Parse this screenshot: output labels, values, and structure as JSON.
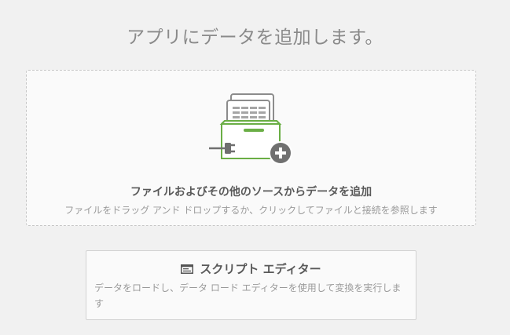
{
  "page": {
    "title": "アプリにデータを追加します。"
  },
  "drop_zone": {
    "title": "ファイルおよびその他のソースからデータを追加",
    "subtitle": "ファイルをドラッグ アンド ドロップするか、クリックしてファイルと接続を参照します",
    "icon": "data-source-plug-icon",
    "accent_color": "#6aae45"
  },
  "script_editor": {
    "title": "スクリプト エディター",
    "description": "データをロードし、データ ロード エディターを使用して変換を実行します",
    "icon": "script-editor-icon"
  }
}
